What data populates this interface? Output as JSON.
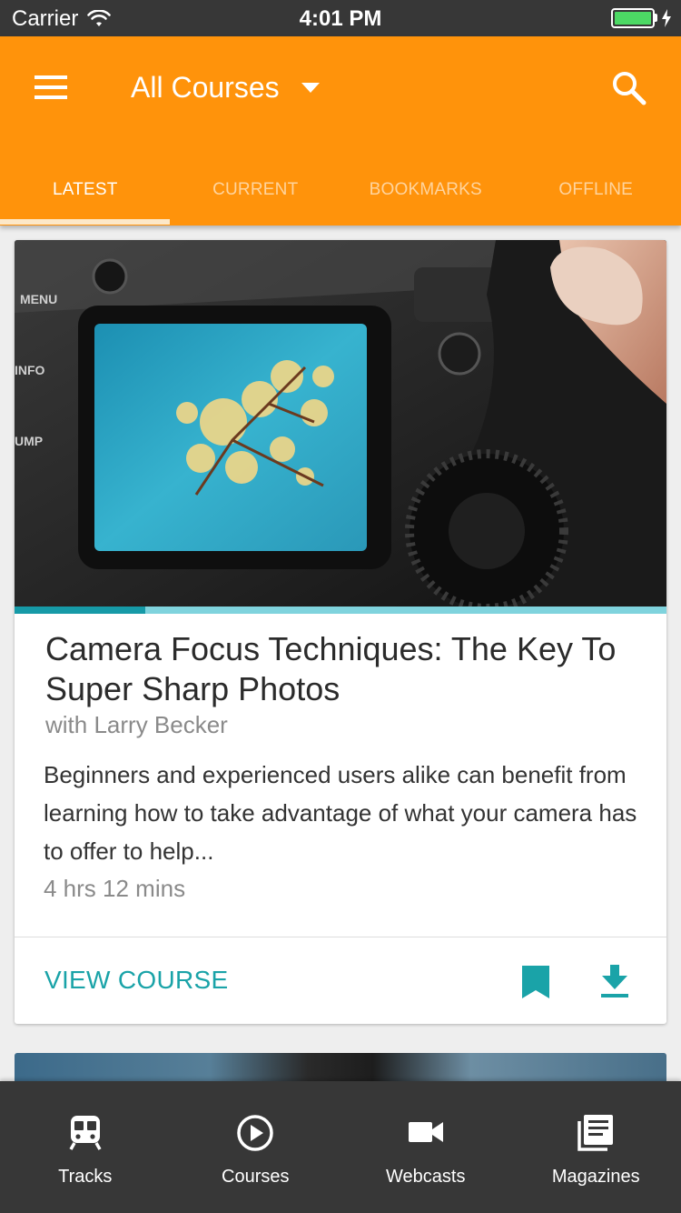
{
  "status_bar": {
    "carrier": "Carrier",
    "time": "4:01 PM",
    "battery_level": 1.0
  },
  "app_bar": {
    "title": "All Courses",
    "menu_icon": "hamburger-menu-icon",
    "dropdown_icon": "caret-down-icon",
    "search_icon": "search-icon",
    "background_color": "#ff930b"
  },
  "tabs": [
    {
      "label": "LATEST",
      "active": true
    },
    {
      "label": "CURRENT",
      "active": false
    },
    {
      "label": "BOOKMARKS",
      "active": false
    },
    {
      "label": "OFFLINE",
      "active": false
    }
  ],
  "course_card": {
    "title": "Camera Focus Techniques: The Key To Super Sharp Photos",
    "author": "with Larry Becker",
    "description": "Beginners and experienced users alike can benefit from learning how to take advantage of what your camera has to offer to help...",
    "duration": "4 hrs 12 mins",
    "progress": 0.2,
    "action_label": "VIEW COURSE",
    "bookmark_icon": "bookmark-icon",
    "download_icon": "download-icon",
    "accent_color": "#1aa3a8"
  },
  "bottom_nav": [
    {
      "label": "Tracks",
      "icon": "train-icon"
    },
    {
      "label": "Courses",
      "icon": "play-circle-icon"
    },
    {
      "label": "Webcasts",
      "icon": "video-camera-icon"
    },
    {
      "label": "Magazines",
      "icon": "newspaper-icon"
    }
  ]
}
